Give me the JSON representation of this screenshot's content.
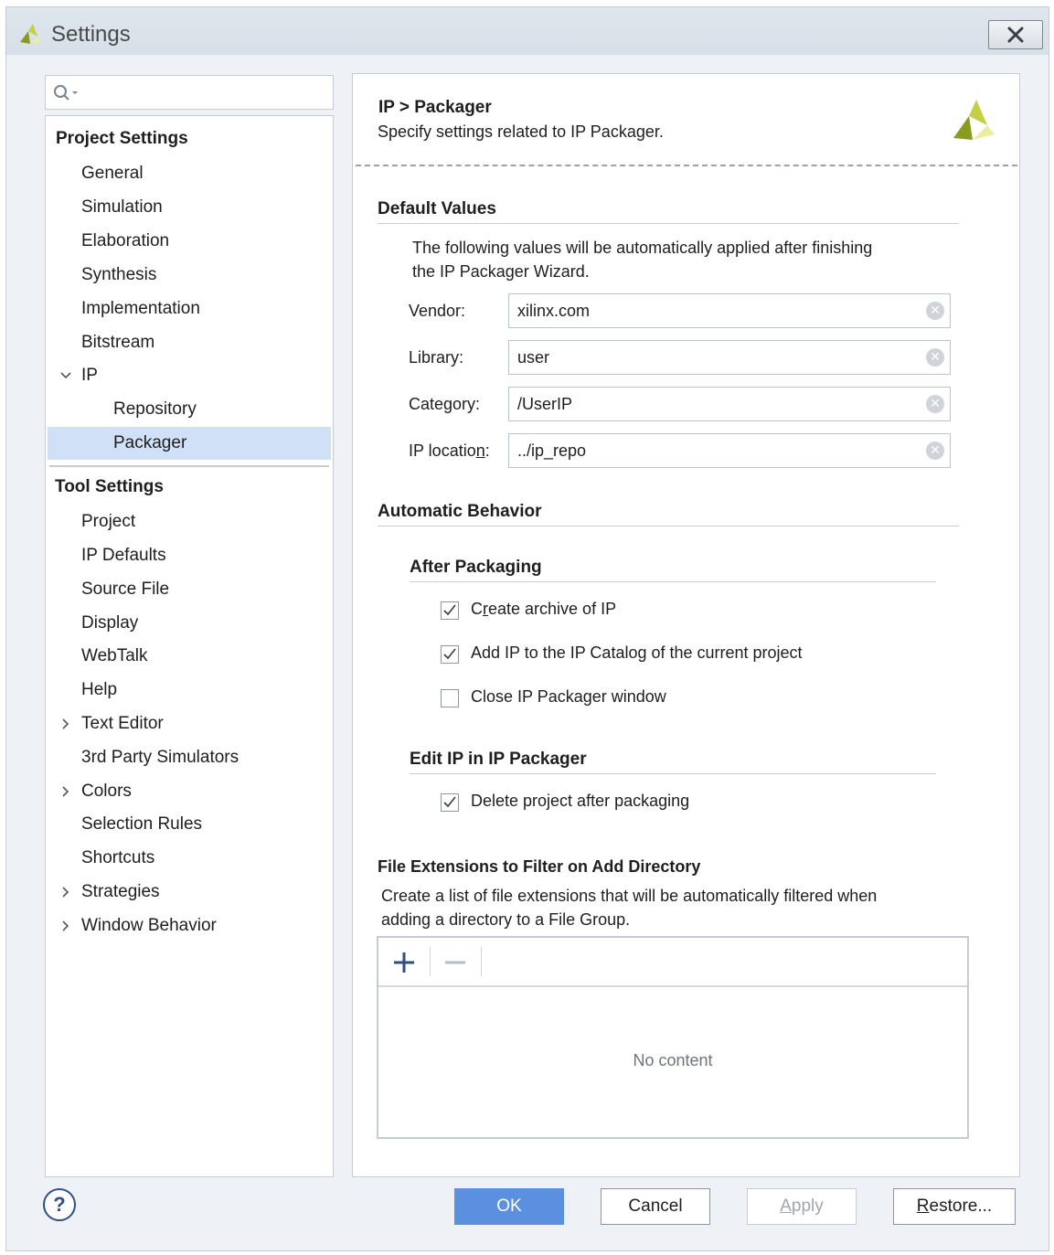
{
  "window": {
    "title": "Settings"
  },
  "search": {
    "placeholder": ""
  },
  "tree": {
    "project_header": "Project Settings",
    "project_items": [
      "General",
      "Simulation",
      "Elaboration",
      "Synthesis",
      "Implementation",
      "Bitstream"
    ],
    "ip_label": "IP",
    "ip_children": [
      "Repository",
      "Packager"
    ],
    "selected": "Packager",
    "tool_header": "Tool Settings",
    "tool_items": [
      "Project",
      "IP Defaults",
      "Source File",
      "Display",
      "WebTalk",
      "Help",
      "Text Editor",
      "3rd Party Simulators",
      "Colors",
      "Selection Rules",
      "Shortcuts",
      "Strategies",
      "Window Behavior"
    ]
  },
  "panel": {
    "breadcrumb": "IP > Packager",
    "description": "Specify settings related to IP Packager.",
    "default_values": {
      "title": "Default Values",
      "intro_line1": "The following values will be automatically applied after finishing",
      "intro_line2": "the IP Packager Wizard.",
      "vendor_label": "Vendor:",
      "vendor_value": "xilinx.com",
      "library_label": "Library:",
      "library_value": "user",
      "category_label": "Category:",
      "category_value": "/UserIP",
      "location_label_pre": "IP locatio",
      "location_label_u": "n",
      "location_label_post": ":",
      "location_value": "../ip_repo"
    },
    "automatic_behavior": {
      "title": "Automatic Behavior",
      "after_packaging": {
        "title": "After Packaging",
        "create_archive_pre": "C",
        "create_archive_u": "r",
        "create_archive_post": "eate archive of IP",
        "create_archive_checked": true,
        "add_ip_label": "Add IP to the IP Catalog of the current project",
        "add_ip_checked": true,
        "close_window_label": "Close IP Packager window",
        "close_window_checked": false
      },
      "edit_ip": {
        "title": "Edit IP in IP Packager",
        "delete_project_label": "Delete project after packaging",
        "delete_project_checked": true
      }
    },
    "file_extensions": {
      "title": "File Extensions to Filter on Add Directory",
      "desc_line1": "Create a list of file extensions that will be automatically filtered when",
      "desc_line2": "adding a directory to a File Group.",
      "empty_text": "No content",
      "add_icon": "plus-icon",
      "remove_icon": "minus-icon"
    }
  },
  "buttons": {
    "ok": "OK",
    "cancel": "Cancel",
    "apply_u": "A",
    "apply_rest": "pply",
    "restore_u": "R",
    "restore_rest": "estore..."
  },
  "colors": {
    "accent": "#5b8fe0",
    "selection": "#cfe0f7",
    "logo": "#8c9a1f"
  }
}
